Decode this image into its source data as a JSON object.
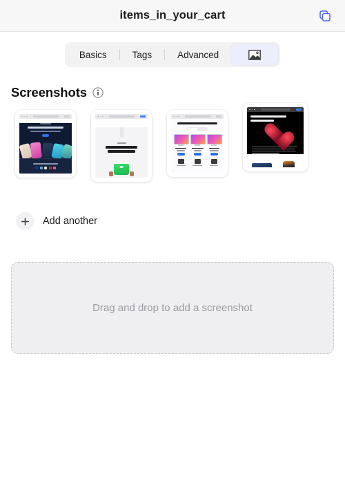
{
  "titlebar": {
    "title": "items_in_your_cart",
    "action_icon": "copy-duplicate-icon",
    "accent": "#4a66e8",
    "background": "#f7f7f7"
  },
  "tabs": {
    "items": [
      {
        "label": "Basics",
        "selected": false,
        "type": "text"
      },
      {
        "label": "Tags",
        "selected": false,
        "type": "text"
      },
      {
        "label": "Advanced",
        "selected": false,
        "type": "text"
      },
      {
        "label": "",
        "selected": true,
        "type": "icon",
        "icon": "image-photo-icon"
      }
    ],
    "selected_background": "#eceefb",
    "track_background": "#f2f2f3"
  },
  "section": {
    "title": "Screenshots",
    "info_icon": "info-circle-icon"
  },
  "screenshots": {
    "items": [
      {
        "name": "screenshot-thumbnail-1",
        "alt": "Dark navy product page with colorful phones"
      },
      {
        "name": "screenshot-thumbnail-2",
        "alt": "Light page with a green bag held by hands"
      },
      {
        "name": "screenshot-thumbnail-3",
        "alt": "Product comparison page with three displays"
      },
      {
        "name": "screenshot-thumbnail-4",
        "alt": "Black page with a red particle heart"
      }
    ]
  },
  "add_another": {
    "label": "Add another",
    "icon": "plus-icon"
  },
  "dropzone": {
    "label": "Drag and drop to add a screenshot",
    "background": "#efeff1",
    "border_color": "#c9c9cd"
  }
}
